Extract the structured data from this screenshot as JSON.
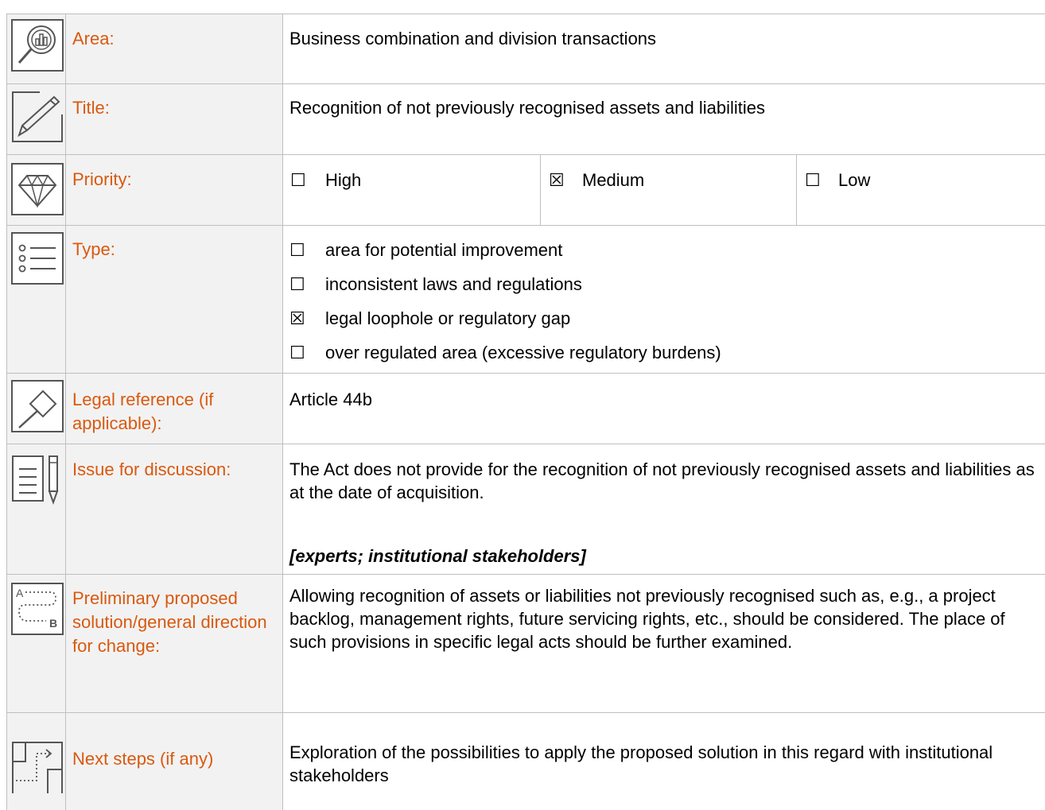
{
  "rows": {
    "area": {
      "label": "Area:",
      "value": "Business combination and division transactions"
    },
    "title": {
      "label": "Title:",
      "value": "Recognition of not previously recognised assets and liabilities"
    },
    "priority": {
      "label": "Priority:",
      "options": [
        {
          "mark": "☐",
          "text": "High"
        },
        {
          "mark": "☒",
          "text": "Medium"
        },
        {
          "mark": "☐",
          "text": "Low"
        }
      ]
    },
    "type": {
      "label": "Type:",
      "options": [
        {
          "mark": "☐",
          "text": "area for potential improvement"
        },
        {
          "mark": "☐",
          "text": "inconsistent laws and regulations"
        },
        {
          "mark": "☒",
          "text": "legal loophole or regulatory gap"
        },
        {
          "mark": "☐",
          "text": "over regulated area (excessive regulatory burdens)"
        }
      ]
    },
    "legal": {
      "label": "Legal reference (if applicable):",
      "value": "Article 44b"
    },
    "issue": {
      "label": "Issue for discussion:",
      "value": "The Act does not provide for the recognition of not previously recognised assets and liabilities as at the date of acquisition.",
      "emphasis": "[experts; institutional stakeholders]"
    },
    "solution": {
      "label": "Preliminary proposed solution/general direction for change:",
      "value": "Allowing recognition of assets or liabilities not previously recognised such as, e.g., a project backlog, management rights, future servicing rights, etc., should be considered. The place of such provisions in specific legal acts should be further examined."
    },
    "next": {
      "label": "Next steps (if any)",
      "value": "Exploration of the possibilities to apply the proposed solution in this regard with institutional stakeholders"
    }
  },
  "icons": {
    "area": "magnifier-chart-icon",
    "title": "pencil-icon",
    "priority": "diamond-icon",
    "type": "list-icon",
    "legal": "gavel-icon",
    "issue": "document-pen-icon",
    "solution": "route-a-b-icon",
    "next": "floorplan-icon"
  },
  "colors": {
    "label": "#d9590f",
    "shade": "#f2f2f2",
    "grid": "#bfbfbf",
    "icon": "#666666"
  }
}
